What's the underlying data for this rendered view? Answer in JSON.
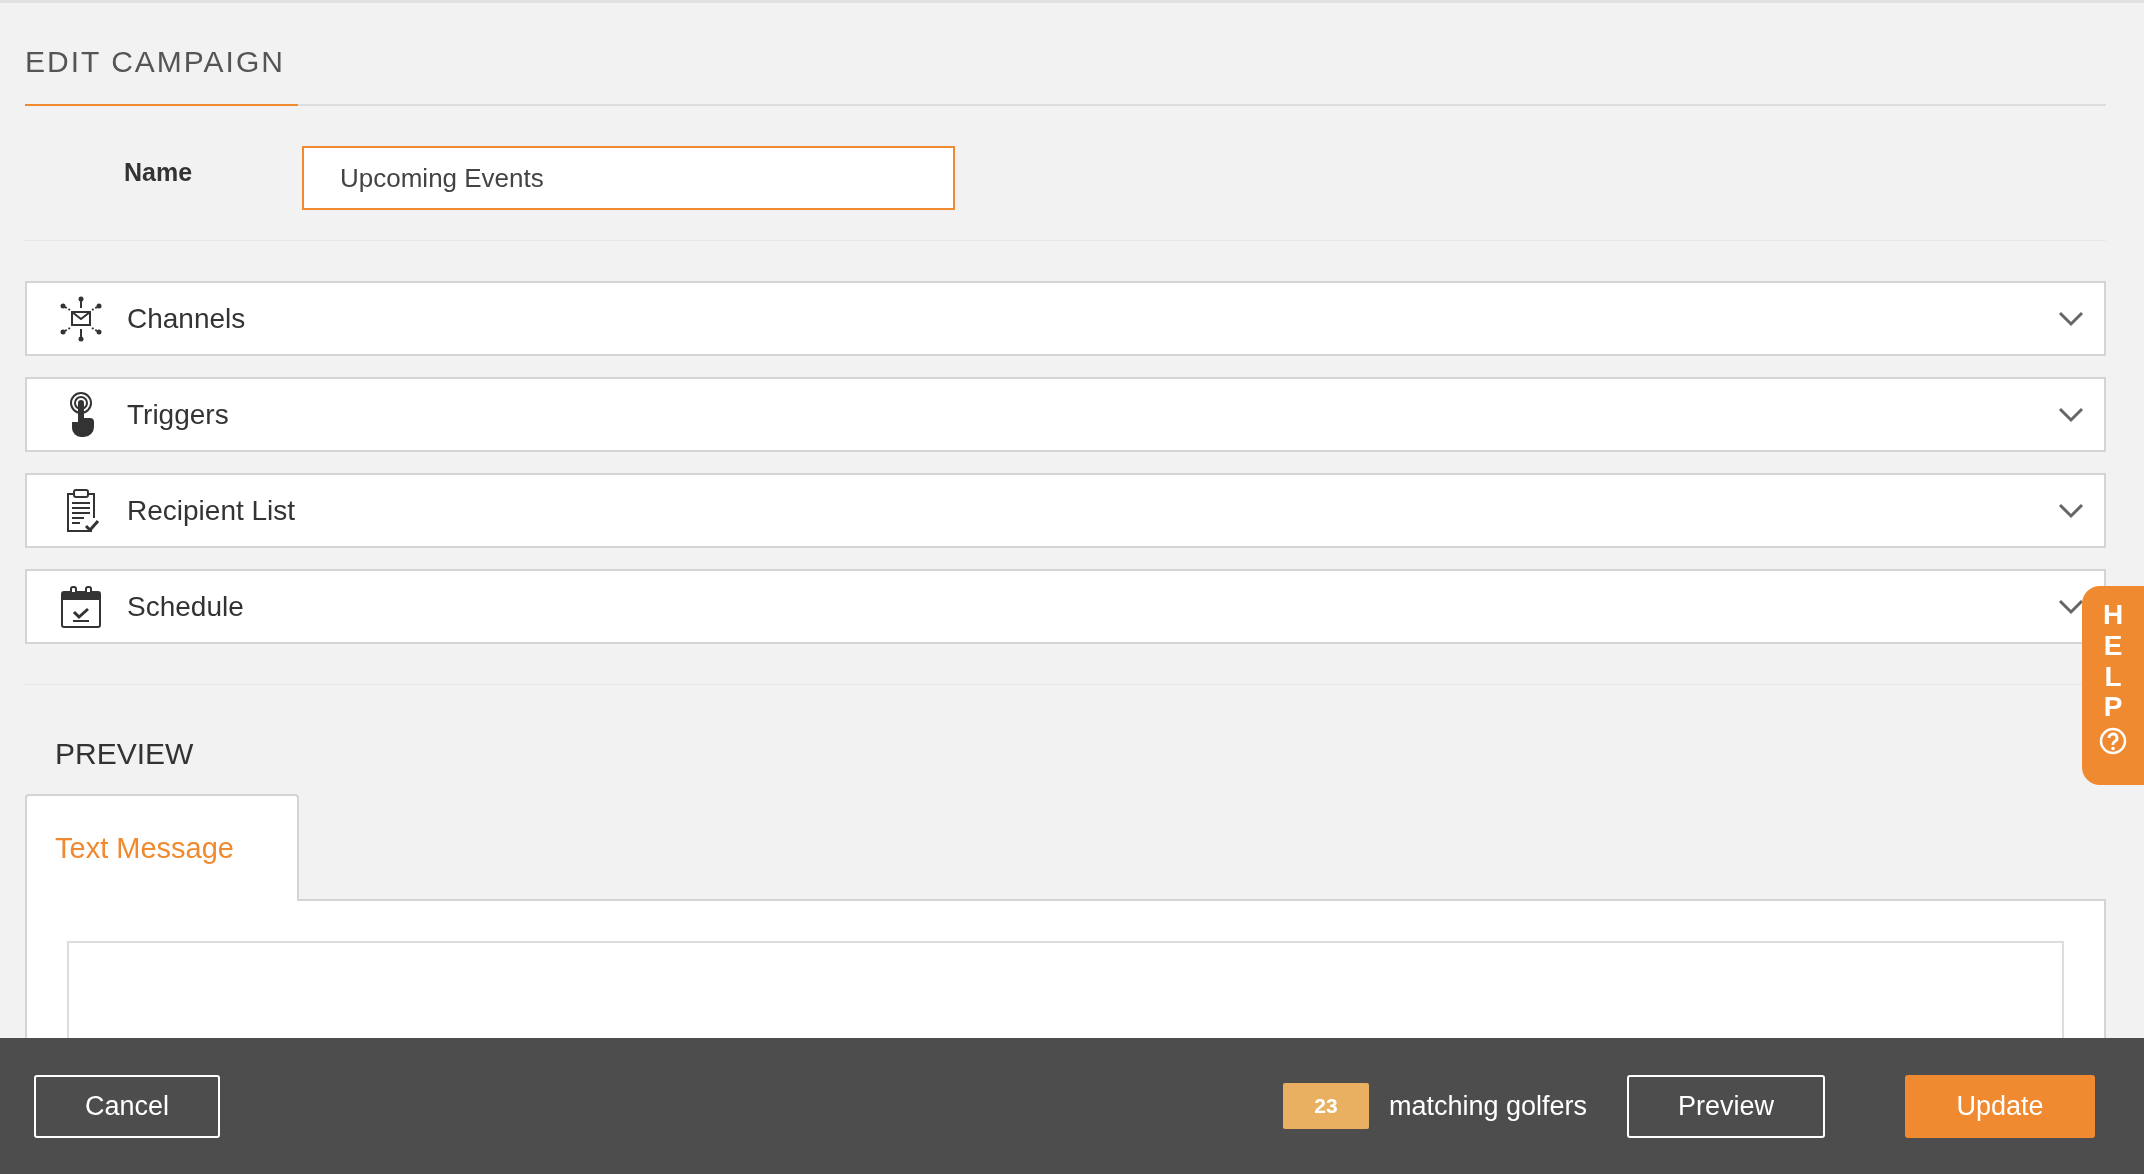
{
  "page": {
    "title": "EDIT CAMPAIGN"
  },
  "name_field": {
    "label": "Name",
    "value": "Upcoming Events"
  },
  "sections": [
    {
      "kind": "channels",
      "label": "Channels",
      "expanded": false
    },
    {
      "kind": "triggers",
      "label": "Triggers",
      "expanded": false
    },
    {
      "kind": "recipients",
      "label": "Recipient List",
      "expanded": false
    },
    {
      "kind": "schedule",
      "label": "Schedule",
      "expanded": false
    }
  ],
  "preview": {
    "heading": "PREVIEW",
    "tabs": [
      {
        "label": "Text Message",
        "selected": true
      }
    ]
  },
  "help": {
    "label": "HELP"
  },
  "footer": {
    "cancel": "Cancel",
    "count": "23",
    "count_label": "matching golfers",
    "preview": "Preview",
    "update": "Update"
  }
}
